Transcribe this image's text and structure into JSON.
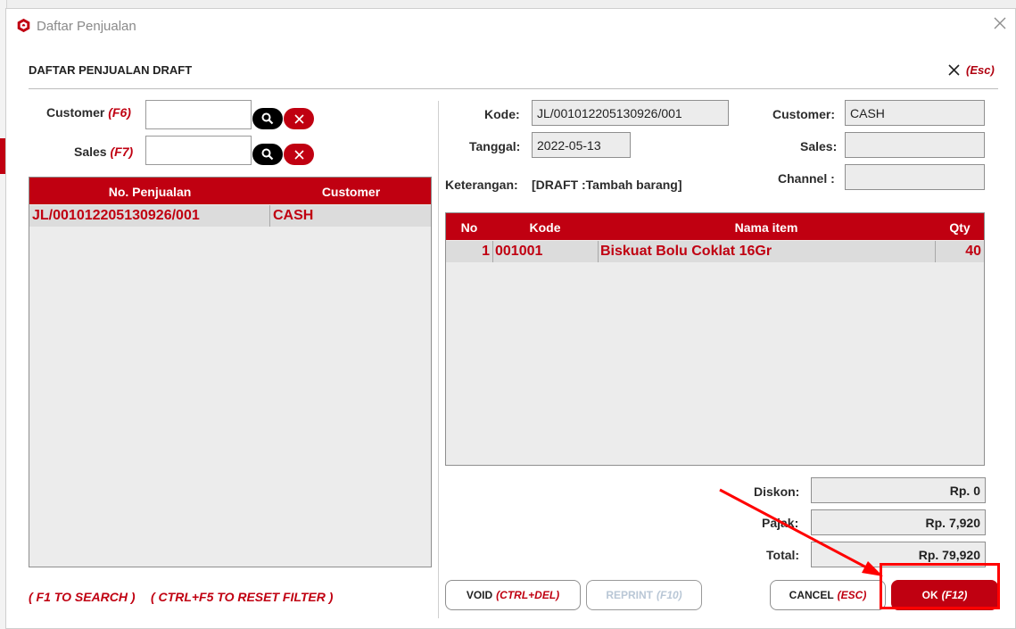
{
  "window": {
    "title": "Daftar Penjualan"
  },
  "header": {
    "title": "DAFTAR PENJUALAN DRAFT",
    "close_hint": "(Esc)"
  },
  "filters": {
    "customer_label": "Customer",
    "customer_key": "(F6)",
    "customer_value": "",
    "sales_label": "Sales",
    "sales_key": "(F7)",
    "sales_value": ""
  },
  "list": {
    "columns": [
      "No. Penjualan",
      "Customer"
    ],
    "rows": [
      {
        "no": "JL/001012205130926/001",
        "customer": "CASH"
      }
    ]
  },
  "detail": {
    "kode_label": "Kode:",
    "kode_value": "JL/001012205130926/001",
    "tanggal_label": "Tanggal:",
    "tanggal_value": "2022-05-13",
    "keterangan_label": "Keterangan:",
    "keterangan_value": "[DRAFT :Tambah barang]",
    "customer_label": "Customer:",
    "customer_value": "CASH",
    "sales_label": "Sales:",
    "sales_value": "",
    "channel_label": "Channel :",
    "channel_value": ""
  },
  "items": {
    "columns": [
      "No",
      "Kode",
      "Nama item",
      "Qty"
    ],
    "rows": [
      {
        "no": "1",
        "kode": "001001",
        "nama": "Biskuat Bolu Coklat 16Gr",
        "qty": "40"
      }
    ]
  },
  "totals": {
    "diskon_label": "Diskon:",
    "diskon_value": "Rp. 0",
    "pajak_label": "Pajak:",
    "pajak_value": "Rp. 7,920",
    "total_label": "Total:",
    "total_value": "Rp. 79,920"
  },
  "hints": {
    "search": "( F1 TO SEARCH )",
    "reset": "( CTRL+F5 TO RESET FILTER )"
  },
  "buttons": {
    "void_label": "VOID",
    "void_key": "(CTRL+DEL)",
    "reprint_label": "REPRINT",
    "reprint_key": "(F10)",
    "cancel_label": "CANCEL",
    "cancel_key": "(ESC)",
    "ok_label": "OK",
    "ok_key": "(F12)"
  },
  "colors": {
    "accent": "#c00011",
    "annotation": "#ff0000"
  }
}
